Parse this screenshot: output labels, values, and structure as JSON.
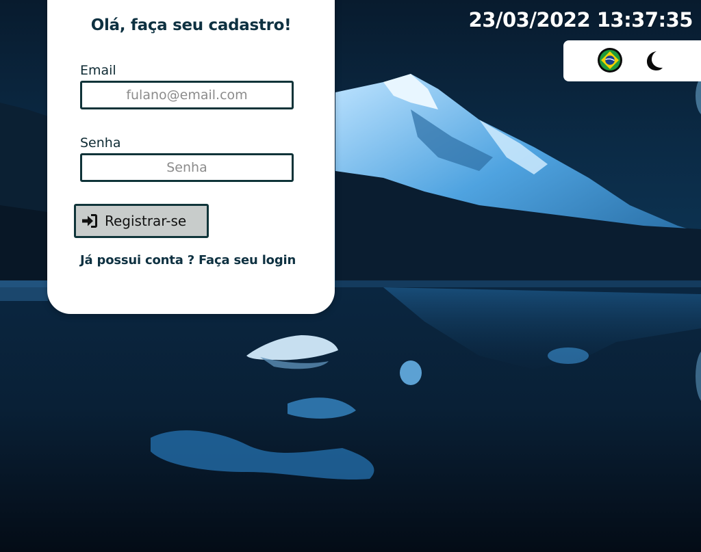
{
  "header": {
    "datetime": "23/03/2022 13:37:35"
  },
  "toolbar": {
    "language_icon": "brazil-flag-icon",
    "theme_icon": "moon-icon"
  },
  "form": {
    "title": "Olá, faça seu cadastro!",
    "email_label": "Email",
    "email_placeholder": "fulano@email.com",
    "email_value": "",
    "password_label": "Senha",
    "password_placeholder": "Senha",
    "password_value": "",
    "register_label": "Registrar-se",
    "register_icon": "sign-in-icon",
    "login_link": "Já possui conta ? Faça seu login"
  },
  "colors": {
    "accent": "#0f3338",
    "button_bg": "#c8cccb",
    "title": "#0e3141",
    "background_night": "#06101c"
  }
}
